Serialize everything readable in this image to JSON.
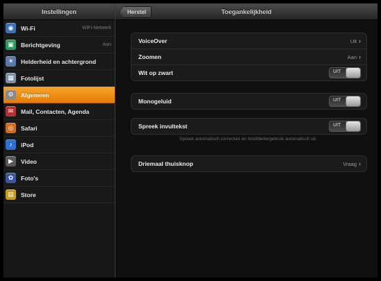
{
  "sidebar": {
    "title": "Instellingen",
    "items": [
      {
        "label": "Wi-Fi",
        "detail": "WiFi-Netwerk",
        "icon": "wifi-icon",
        "color": "#3d6fb8",
        "glyph": "◉",
        "active": false
      },
      {
        "label": "Berichtgeving",
        "detail": "Aan",
        "icon": "notifications-icon",
        "color": "#2e9b5a",
        "glyph": "▣",
        "active": false
      },
      {
        "label": "Helderheid en achtergrond",
        "detail": "",
        "icon": "brightness-icon",
        "color": "#5a78a8",
        "glyph": "☀",
        "active": false
      },
      {
        "label": "Fotolijst",
        "detail": "",
        "icon": "picture-frame-icon",
        "color": "#7f8fa8",
        "glyph": "▦",
        "active": false
      },
      {
        "label": "Algemeen",
        "detail": "",
        "icon": "general-gear-icon",
        "color": "#8a8a8a",
        "glyph": "⚙",
        "active": true
      },
      {
        "label": "Mail, Contacten, Agenda",
        "detail": "",
        "icon": "mail-icon",
        "color": "#b53030",
        "glyph": "✉",
        "active": false
      },
      {
        "label": "Safari",
        "detail": "",
        "icon": "safari-icon",
        "color": "#d06a1c",
        "glyph": "◎",
        "active": false
      },
      {
        "label": "iPod",
        "detail": "",
        "icon": "ipod-icon",
        "color": "#2f6fd0",
        "glyph": "♪",
        "active": false
      },
      {
        "label": "Video",
        "detail": "",
        "icon": "video-icon",
        "color": "#5a5a5a",
        "glyph": "▶",
        "active": false
      },
      {
        "label": "Foto's",
        "detail": "",
        "icon": "photos-icon",
        "color": "#3a56a0",
        "glyph": "✿",
        "active": false
      },
      {
        "label": "Store",
        "detail": "",
        "icon": "store-icon",
        "color": "#c79a1e",
        "glyph": "▤",
        "active": false
      }
    ]
  },
  "main": {
    "back_label": "Herstel",
    "title": "Toegankelijkheid",
    "groups": [
      {
        "rows": [
          {
            "label": "VoiceOver",
            "value": "Uit",
            "kind": "disclosure"
          },
          {
            "label": "Zoomen",
            "value": "Aan",
            "kind": "disclosure"
          },
          {
            "label": "Wit op zwart",
            "value": "UIT",
            "kind": "toggle"
          }
        ]
      },
      {
        "rows": [
          {
            "label": "Monogeluid",
            "value": "UIT",
            "kind": "toggle"
          }
        ]
      },
      {
        "rows": [
          {
            "label": "Spreek invultekst",
            "value": "UIT",
            "kind": "toggle"
          }
        ]
      },
      {
        "rows": [
          {
            "label": "Driemaal thuisknop",
            "value": "Vraag",
            "kind": "disclosure"
          }
        ]
      }
    ],
    "footnote": "Spreek automatisch correcties en hoofdlettergebruik automatisch uit."
  },
  "colors": {
    "accent": "#ee8a12",
    "background": "#101010",
    "sidebar_background": "#171717"
  }
}
